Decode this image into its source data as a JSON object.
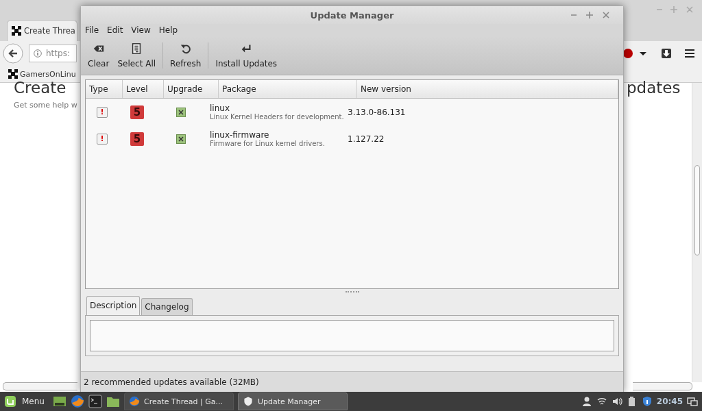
{
  "browser": {
    "tab_title": "Create Threa",
    "url": "https:",
    "bookmark": "GamersOnLinu",
    "heading": "Create",
    "subheading": "Get some help w",
    "heading_right": "pdates"
  },
  "window": {
    "title": "Update Manager",
    "menu": [
      "File",
      "Edit",
      "View",
      "Help"
    ],
    "toolbar": [
      {
        "label": "Clear"
      },
      {
        "label": "Select All"
      },
      {
        "label": "Refresh"
      },
      {
        "label": "Install Updates"
      }
    ],
    "columns": [
      "Type",
      "Level",
      "Upgrade",
      "Package",
      "New version"
    ],
    "rows": [
      {
        "type": "!",
        "level": "5",
        "checked": true,
        "package": "linux",
        "description": "Linux Kernel Headers for development.",
        "version": "3.13.0-86.131"
      },
      {
        "type": "!",
        "level": "5",
        "checked": true,
        "package": "linux-firmware",
        "description": "Firmware for Linux kernel drivers.",
        "version": "1.127.22"
      }
    ],
    "tabs": [
      {
        "label": "Description",
        "selected": true
      },
      {
        "label": "Changelog",
        "selected": false
      }
    ],
    "status": "2 recommended updates available (32MB)"
  },
  "taskbar": {
    "menu_label": "Menu",
    "windows": [
      {
        "label": "Create Thread | Ga...",
        "selected": false
      },
      {
        "label": "Update Manager",
        "selected": true
      }
    ],
    "clock": "20:45"
  }
}
